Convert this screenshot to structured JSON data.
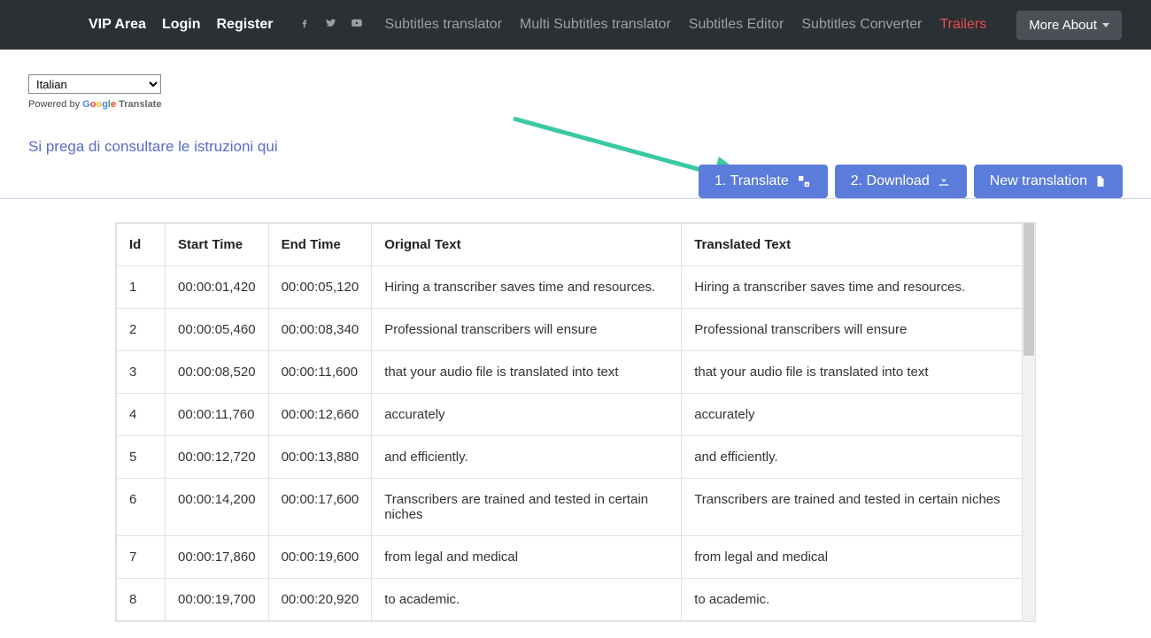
{
  "nav": {
    "vip": "VIP Area",
    "login": "Login",
    "register": "Register",
    "subtitles_translator": "Subtitles translator",
    "multi_translator": "Multi Subtitles translator",
    "editor": "Subtitles Editor",
    "converter": "Subtitles Converter",
    "trailers": "Trailers",
    "more_about": "More About"
  },
  "lang": {
    "selected": "Italian",
    "powered_prefix": "Powered by ",
    "translate_word": " Translate"
  },
  "instructions_link": "Si prega di consultare le istruzioni qui",
  "buttons": {
    "translate": "1. Translate",
    "download": "2. Download",
    "new_translation": "New translation"
  },
  "table": {
    "headers": {
      "id": "Id",
      "start": "Start Time",
      "end": "End Time",
      "orig": "Orignal Text",
      "trans": "Translated Text"
    },
    "rows": [
      {
        "id": "1",
        "start": "00:00:01,420",
        "end": "00:00:05,120",
        "orig": "Hiring a transcriber saves time and resources.",
        "trans": "Hiring a transcriber saves time and resources."
      },
      {
        "id": "2",
        "start": "00:00:05,460",
        "end": "00:00:08,340",
        "orig": "Professional transcribers will ensure",
        "trans": "Professional transcribers will ensure"
      },
      {
        "id": "3",
        "start": "00:00:08,520",
        "end": "00:00:11,600",
        "orig": "that your audio file is translated into text",
        "trans": "that your audio file is translated into text"
      },
      {
        "id": "4",
        "start": "00:00:11,760",
        "end": "00:00:12,660",
        "orig": "accurately",
        "trans": "accurately"
      },
      {
        "id": "5",
        "start": "00:00:12,720",
        "end": "00:00:13,880",
        "orig": "and efficiently.",
        "trans": "and efficiently."
      },
      {
        "id": "6",
        "start": "00:00:14,200",
        "end": "00:00:17,600",
        "orig": "Transcribers are trained and tested in certain niches",
        "trans": "Transcribers are trained and tested in certain niches"
      },
      {
        "id": "7",
        "start": "00:00:17,860",
        "end": "00:00:19,600",
        "orig": "from legal and medical",
        "trans": "from legal and medical"
      },
      {
        "id": "8",
        "start": "00:00:19,700",
        "end": "00:00:20,920",
        "orig": "to academic.",
        "trans": "to academic."
      }
    ]
  }
}
